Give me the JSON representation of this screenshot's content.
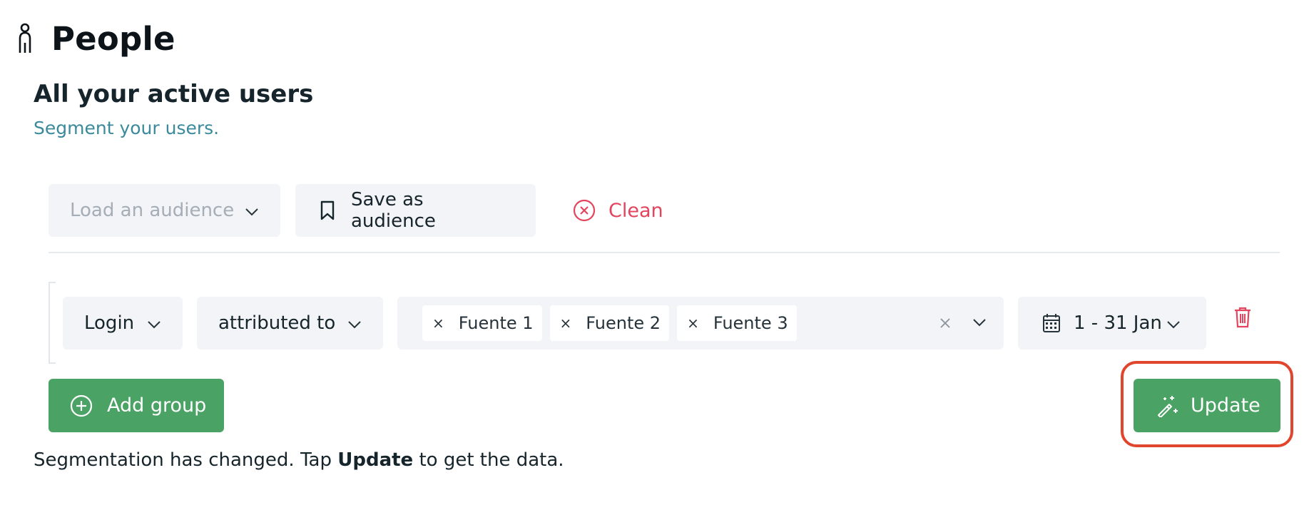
{
  "page": {
    "title": "People",
    "icon": "person-icon"
  },
  "section": {
    "title": "All your active users",
    "subtitle": "Segment your users."
  },
  "toolbar": {
    "load_audience_placeholder": "Load an audience",
    "save_audience_label": "Save as audience",
    "clean_label": "Clean"
  },
  "filter": {
    "event": "Login",
    "relation": "attributed to",
    "sources": [
      {
        "label": "Fuente 1"
      },
      {
        "label": "Fuente 2"
      },
      {
        "label": "Fuente 3"
      }
    ],
    "chip_remove_glyph": "×",
    "date_range": "1 - 31 Jan"
  },
  "actions": {
    "add_group_label": "Add group",
    "update_label": "Update"
  },
  "status": {
    "prefix": "Segmentation has changed. Tap ",
    "emphasis": "Update",
    "suffix": " to get the data."
  },
  "colors": {
    "accent_green": "#4aa264",
    "danger_red": "#e2455d",
    "subtitle_teal": "#3a8a9b",
    "highlight_ring": "#e0452d"
  }
}
